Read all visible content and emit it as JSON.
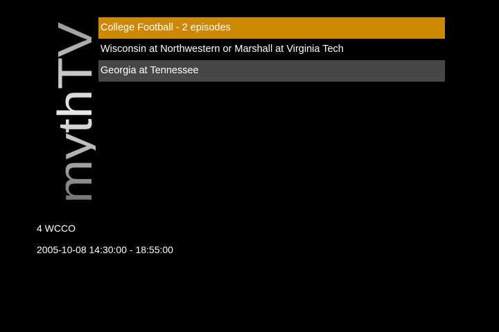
{
  "app": {
    "logo_text": "mythTV",
    "accent_color": "#cc8800",
    "row_dim_color": "#474747",
    "background": "#000000"
  },
  "menu": {
    "items": [
      {
        "label": "College Football - 2 episodes",
        "state": "selected"
      },
      {
        "label": "Wisconsin at Northwestern or Marshall at Virginia Tech",
        "state": "normal"
      },
      {
        "label": "Georgia at Tennessee",
        "state": "dim"
      }
    ]
  },
  "details": {
    "channel": "4 WCCO",
    "timespan": "2005-10-08 14:30:00 - 18:55:00"
  }
}
